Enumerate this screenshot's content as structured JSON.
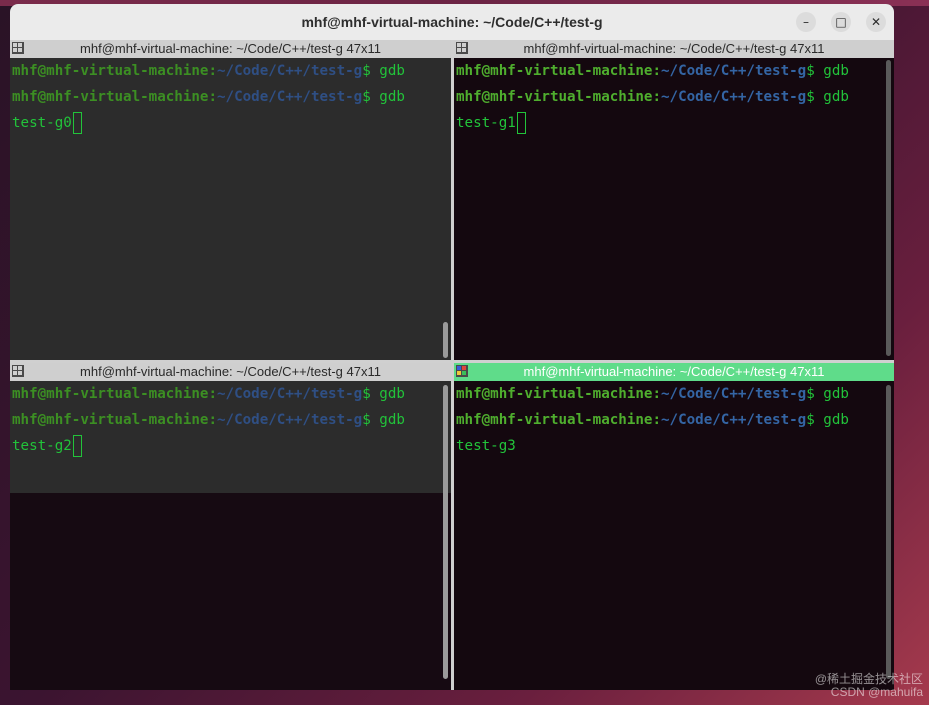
{
  "window": {
    "title": "mhf@mhf-virtual-machine: ~/Code/C++/test-g",
    "minimize_icon": "minimize-icon",
    "maximize_icon": "maximize-icon",
    "close_icon": "close-icon"
  },
  "panes": [
    {
      "header": "mhf@mhf-virtual-machine: ~/Code/C++/test-g 47x11",
      "lines": [
        {
          "user": "mhf@mhf-virtual-machine:",
          "path": "~/Code/C++/test-g",
          "cmd": "$ gdb"
        },
        {
          "user": "mhf@mhf-virtual-machine:",
          "path": "~/Code/C++/test-g",
          "cmd": "$ gdb"
        }
      ],
      "output": "test-g0"
    },
    {
      "header": "mhf@mhf-virtual-machine: ~/Code/C++/test-g 47x11",
      "lines": [
        {
          "user": "mhf@mhf-virtual-machine:",
          "path": "~/Code/C++/test-g",
          "cmd": "$ gdb"
        },
        {
          "user": "mhf@mhf-virtual-machine:",
          "path": "~/Code/C++/test-g",
          "cmd": "$ gdb"
        }
      ],
      "output": "test-g1"
    },
    {
      "header": "mhf@mhf-virtual-machine: ~/Code/C++/test-g 47x11",
      "lines": [
        {
          "user": "mhf@mhf-virtual-machine:",
          "path": "~/Code/C++/test-g",
          "cmd": "$ gdb"
        },
        {
          "user": "mhf@mhf-virtual-machine:",
          "path": "~/Code/C++/test-g",
          "cmd": "$ gdb"
        }
      ],
      "output": "test-g2"
    },
    {
      "header": "mhf@mhf-virtual-machine: ~/Code/C++/test-g 47x11",
      "lines": [
        {
          "user": "mhf@mhf-virtual-machine:",
          "path": "~/Code/C++/test-g",
          "cmd": "$ gdb"
        },
        {
          "user": "mhf@mhf-virtual-machine:",
          "path": "~/Code/C++/test-g",
          "cmd": "$ gdb"
        }
      ],
      "output": "test-g3"
    }
  ],
  "watermark": {
    "line1": "@稀土掘金技术社区",
    "line2": "CSDN @mahuifa"
  },
  "colors": {
    "active_header": "#5fdc8a",
    "prompt_user": "#4fae2e",
    "prompt_path": "#3465a4",
    "output": "#22c33a"
  }
}
